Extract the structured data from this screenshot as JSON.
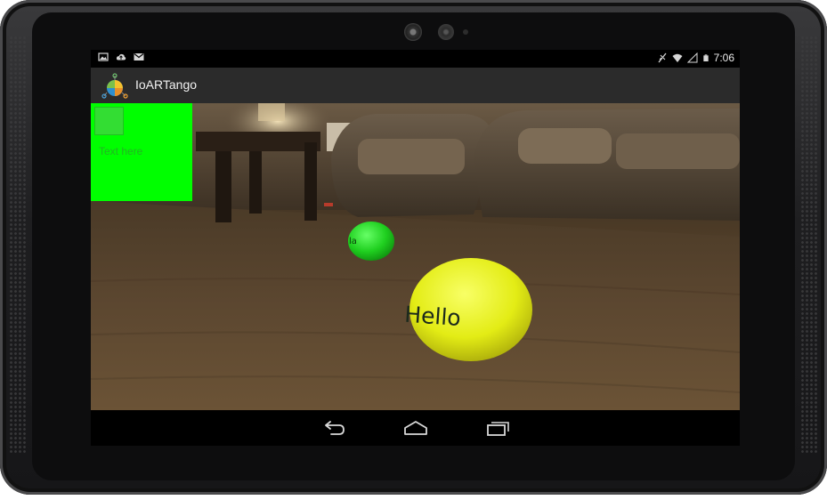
{
  "app": {
    "title": "IoARTango"
  },
  "status_bar": {
    "time": "7:06",
    "left_icons": [
      "image-icon",
      "cloud-upload-icon",
      "gmail-icon"
    ],
    "right_icons": [
      "no-signal-icon",
      "wifi-icon",
      "cell-signal-icon",
      "battery-icon"
    ]
  },
  "overlay": {
    "panel_color": "#00ff00",
    "text_placeholder": "Text here"
  },
  "ar_objects": [
    {
      "name": "green-sphere",
      "label": "la",
      "color": "#22dd22"
    },
    {
      "name": "yellow-sphere",
      "label": "Hello",
      "color": "#e6f011"
    }
  ],
  "nav_bar": {
    "icons": [
      "back-icon",
      "home-icon",
      "recent-apps-icon"
    ]
  }
}
